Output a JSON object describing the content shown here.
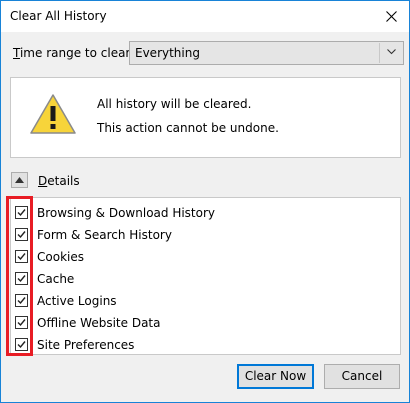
{
  "window": {
    "title": "Clear All History"
  },
  "time_range": {
    "label_prefix": "T",
    "label_rest": "ime range to clear:",
    "selected": "Everything"
  },
  "warning": {
    "line1": "All history will be cleared.",
    "line2": "This action cannot be undone."
  },
  "details": {
    "label_prefix": "D",
    "label_rest": "etails",
    "items": [
      {
        "label": "Browsing & Download History",
        "checked": true
      },
      {
        "label": "Form & Search History",
        "checked": true
      },
      {
        "label": "Cookies",
        "checked": true
      },
      {
        "label": "Cache",
        "checked": true
      },
      {
        "label": "Active Logins",
        "checked": true
      },
      {
        "label": "Offline Website Data",
        "checked": true
      },
      {
        "label": "Site Preferences",
        "checked": true
      }
    ]
  },
  "buttons": {
    "clear_now": "Clear Now",
    "cancel": "Cancel"
  },
  "colors": {
    "window_border": "#1883d7",
    "highlight": "#e81c24",
    "default_button_border": "#0078d7"
  },
  "icons": {
    "close": "close-icon",
    "warning": "warning-triangle-icon",
    "dropdown": "chevron-down-icon",
    "details_toggle": "chevron-up-icon",
    "checkbox": "checkmark-icon"
  }
}
